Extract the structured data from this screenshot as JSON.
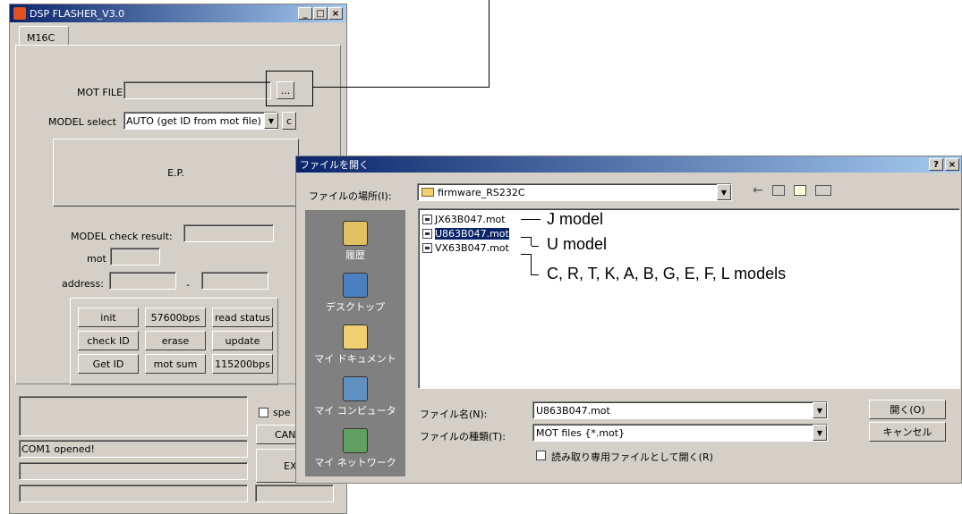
{
  "app": {
    "title": "DSP FLASHER_V3.0",
    "tab": "M16C",
    "mot_file_label": "MOT FILE",
    "browse_label": "...",
    "model_select_label": "MODEL select",
    "model_select_value": "AUTO (get ID from mot file)",
    "c_label": "c",
    "ep_label": "E.P.",
    "model_check_label": "MODEL check result:",
    "mot_label": "mot",
    "address_label": "address:",
    "address_sep": "-",
    "buttons": [
      [
        "init",
        "57600bps",
        "read status"
      ],
      [
        "check ID",
        "erase",
        "update"
      ],
      [
        "Get ID",
        "mot sum",
        "115200bps"
      ]
    ],
    "spe_label": "spe",
    "can_label": "CAN",
    "ex_label": "EX",
    "status": "COM1 opened!"
  },
  "dialog": {
    "title": "ファイルを開く",
    "location_label": "ファイルの場所(I):",
    "location_value": "firmware_RS232C",
    "places": [
      "履歴",
      "デスクトップ",
      "マイ ドキュメント",
      "マイ コンピュータ",
      "マイ ネットワーク"
    ],
    "files": [
      "JX63B047.mot",
      "U863B047.mot",
      "VX63B047.mot"
    ],
    "filename_label": "ファイル名(N):",
    "filename_value": "U863B047.mot",
    "filetype_label": "ファイルの種類(T):",
    "filetype_value": "MOT files {*.mot}",
    "readonly_label": "読み取り専用ファイルとして開く(R)",
    "open_button": "開く(O)",
    "cancel_button": "キャンセル",
    "help_btn": "?",
    "close_btn": "×"
  },
  "annotations": {
    "j": "J model",
    "u": "U model",
    "c": "C, R, T, K, A, B, G, E, F, L models"
  }
}
